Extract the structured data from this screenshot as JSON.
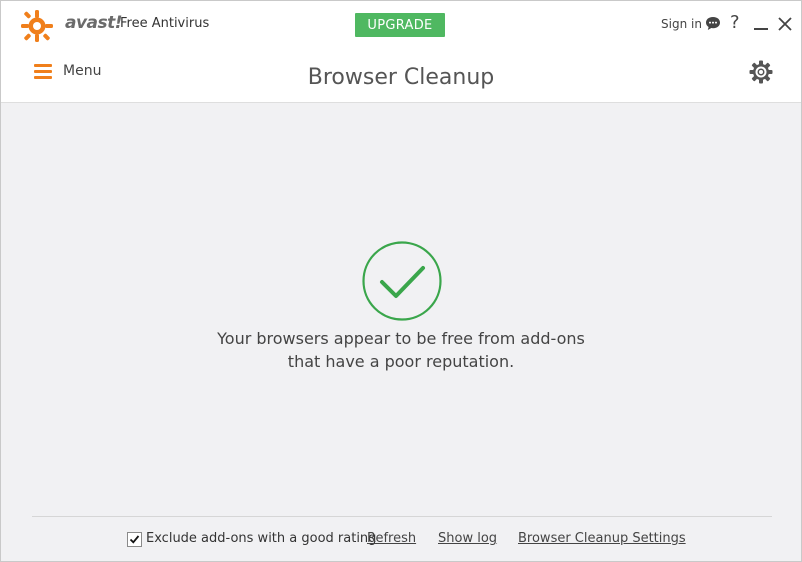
{
  "header": {
    "brand": "avast!",
    "product": "Free Antivirus",
    "upgrade_label": "UPGRADE",
    "signin_label": "Sign in",
    "help_label": "?",
    "brand_color": "#f07f1b",
    "upgrade_color": "#4fb861"
  },
  "nav": {
    "menu_label": "Menu",
    "page_title": "Browser Cleanup"
  },
  "main": {
    "status_icon": "check-circle-icon",
    "status_color": "#3aa64b",
    "message_line1": "Your browsers appear to be free from add-ons",
    "message_line2": "that have a poor reputation."
  },
  "footer": {
    "exclude_label": "Exclude add-ons with a good rating",
    "exclude_checked": true,
    "refresh_label": "Refresh",
    "show_log_label": "Show log",
    "settings_label": "Browser Cleanup Settings"
  }
}
